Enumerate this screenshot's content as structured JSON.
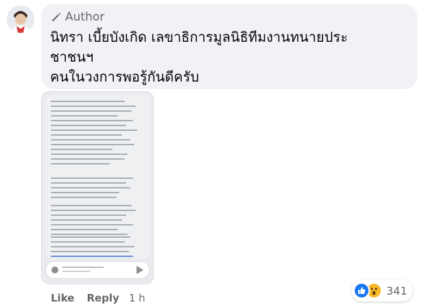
{
  "comment": {
    "badge_label": "Author",
    "text_lines": [
      "นิทรา เบี้ยบังเกิด เลขาธิการมูลนิธิทีมงานทนายประ",
      "ชาชนฯ",
      "คนในวงการพอรู้กันดีครับ"
    ]
  },
  "attachment": {
    "kind": "screenshot",
    "icons": [
      "camera-icon",
      "send-icon"
    ]
  },
  "actions": {
    "like_label": "Like",
    "reply_label": "Reply",
    "time_label": "1 h"
  },
  "reactions": {
    "icons": [
      "like-reaction-icon",
      "wow-reaction-icon"
    ],
    "count": "341"
  },
  "colors": {
    "bubble": "#f0f2f5",
    "link_blue": "#1877f2",
    "muted": "#65676b"
  }
}
